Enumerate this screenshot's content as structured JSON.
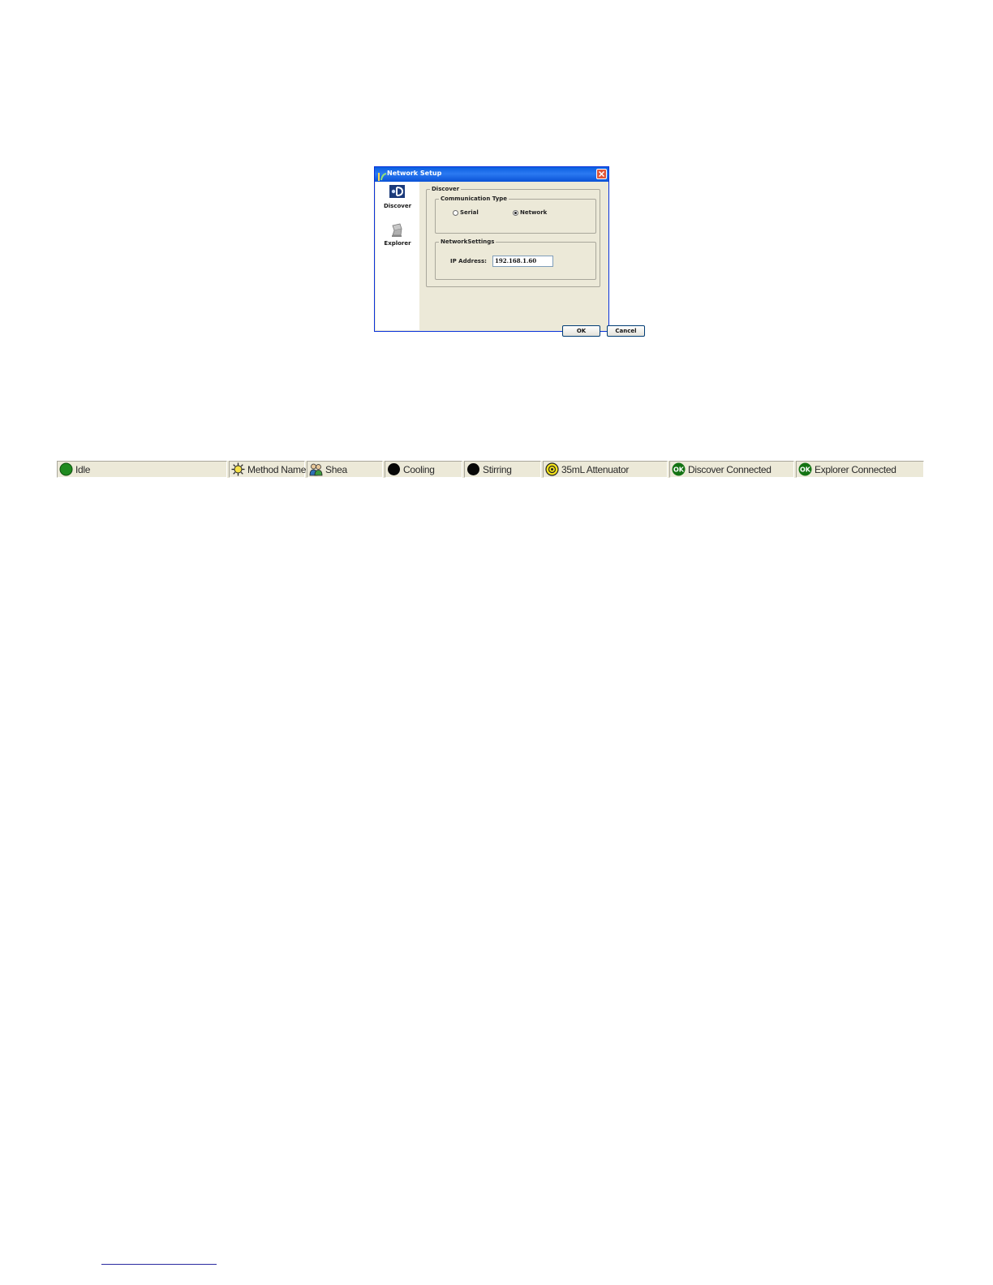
{
  "dialog": {
    "title": "Network Setup",
    "sidebar": {
      "items": [
        {
          "label": "Discover",
          "icon": "discover-icon"
        },
        {
          "label": "Explorer",
          "icon": "explorer-icon"
        }
      ]
    },
    "discover_group": {
      "legend": "Discover",
      "communication_type": {
        "legend": "Communication Type",
        "options": [
          {
            "label": "Serial",
            "selected": false
          },
          {
            "label": "Network",
            "selected": true
          }
        ]
      },
      "network_settings": {
        "legend": "NetworkSettings",
        "ip_label": "IP Address:",
        "ip_value": "192.168.1.60"
      }
    },
    "buttons": {
      "ok": "OK",
      "cancel": "Cancel"
    }
  },
  "status_bar": {
    "panels": [
      {
        "text": "Idle",
        "icon": "green-circle-icon"
      },
      {
        "text": "Method Name",
        "icon": "sun-icon"
      },
      {
        "text": "Shea",
        "icon": "users-icon"
      },
      {
        "text": "Cooling",
        "icon": "black-circle-icon"
      },
      {
        "text": "Stirring",
        "icon": "black-circle-icon"
      },
      {
        "text": "35mL Attenuator",
        "icon": "yellow-attenuator-icon"
      },
      {
        "text": "Discover Connected",
        "icon": "ok-icon"
      },
      {
        "text": "Explorer Connected",
        "icon": "ok-icon"
      }
    ]
  },
  "colors": {
    "titlebar": "#0a5fe0",
    "dialog_bg": "#ece9d8",
    "status_green": "#1f8a1f",
    "ok_green": "#137313",
    "attenuator_yellow": "#f2e21a"
  }
}
